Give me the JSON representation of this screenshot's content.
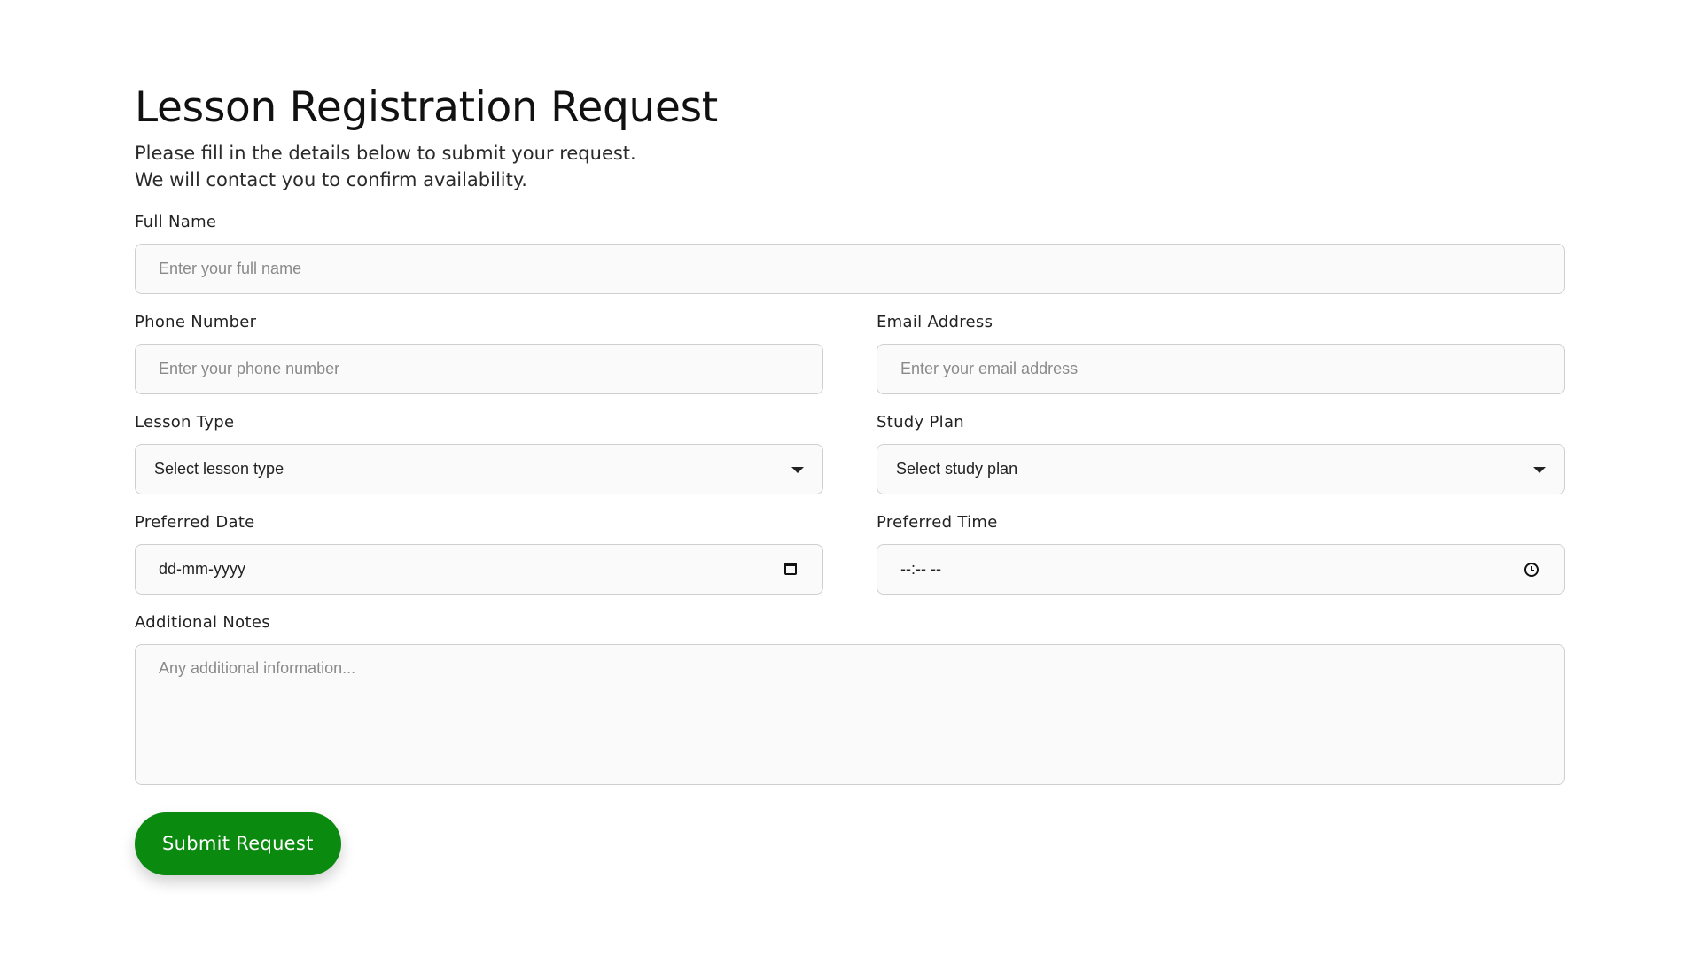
{
  "header": {
    "title": "Lesson Registration Request",
    "subtitle_line1": "Please fill in the details below to submit your request.",
    "subtitle_line2": "We will contact you to confirm availability."
  },
  "form": {
    "full_name": {
      "label": "Full Name",
      "placeholder": "Enter your full name"
    },
    "phone": {
      "label": "Phone Number",
      "placeholder": "Enter your phone number"
    },
    "email": {
      "label": "Email Address",
      "placeholder": "Enter your email address"
    },
    "lesson_type": {
      "label": "Lesson Type",
      "selected": "Select lesson type"
    },
    "study_plan": {
      "label": "Study Plan",
      "selected": "Select study plan"
    },
    "preferred_date": {
      "label": "Preferred Date",
      "value": "dd-mm-yyyy"
    },
    "preferred_time": {
      "label": "Preferred Time",
      "value": "--:-- --"
    },
    "notes": {
      "label": "Additional Notes",
      "placeholder": "Any additional information..."
    },
    "submit_label": "Submit Request"
  },
  "colors": {
    "accent": "#0a8a0f",
    "field_border": "#cfcfcf",
    "field_bg": "#fafafa"
  },
  "icons": {
    "select_caret": "caret-down-icon",
    "date": "calendar-icon",
    "time": "clock-icon"
  }
}
